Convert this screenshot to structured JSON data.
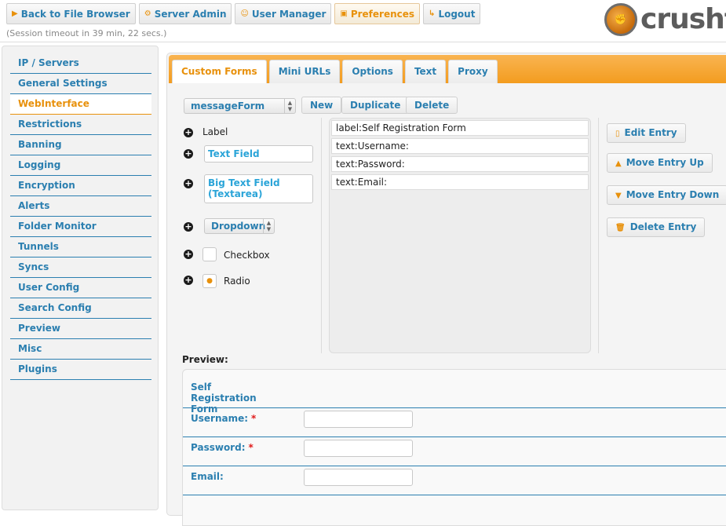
{
  "topnav": {
    "items": [
      {
        "label": "Back to File Browser",
        "icon": "▶"
      },
      {
        "label": "Server Admin",
        "icon": "⚙"
      },
      {
        "label": "User Manager",
        "icon": "☺"
      },
      {
        "label": "Preferences",
        "icon": "▣"
      },
      {
        "label": "Logout",
        "icon": "↳"
      }
    ],
    "session": "(Session timeout in 39 min, 22 secs.)",
    "logo_text": "crushf"
  },
  "sidebar": {
    "items": [
      "IP / Servers",
      "General Settings",
      "WebInterface",
      "Restrictions",
      "Banning",
      "Logging",
      "Encryption",
      "Alerts",
      "Folder Monitor",
      "Tunnels",
      "Syncs",
      "User Config",
      "Search Config",
      "Preview",
      "Misc",
      "Plugins"
    ],
    "active": "WebInterface"
  },
  "tabs": [
    "Custom Forms",
    "Mini URLs",
    "Options",
    "Text",
    "Proxy"
  ],
  "form_select": {
    "value": "messageForm"
  },
  "form_buttons": {
    "new": "New",
    "duplicate": "Duplicate",
    "delete": "Delete"
  },
  "components": {
    "label": "Label",
    "text_field": "Text Field",
    "textarea": "Big Text Field (Textarea)",
    "dropdown": "Dropdown",
    "checkbox": "Checkbox",
    "radio": "Radio"
  },
  "entries": [
    "label:Self Registration Form",
    "text:Username:",
    "text:Password:",
    "text:Email:"
  ],
  "entry_actions": {
    "edit": "Edit Entry",
    "up": "Move Entry Up",
    "down": "Move Entry Down",
    "delete": "Delete Entry"
  },
  "preview": {
    "heading": "Preview:",
    "title": "Self Registration Form",
    "fields": [
      {
        "label": "Username:",
        "required": "*"
      },
      {
        "label": "Password:",
        "required": "*"
      },
      {
        "label": "Email:",
        "required": ""
      }
    ]
  },
  "colors": {
    "accent": "#e8910c",
    "link": "#2b7fb0",
    "tabbar": "#f39c1f"
  }
}
